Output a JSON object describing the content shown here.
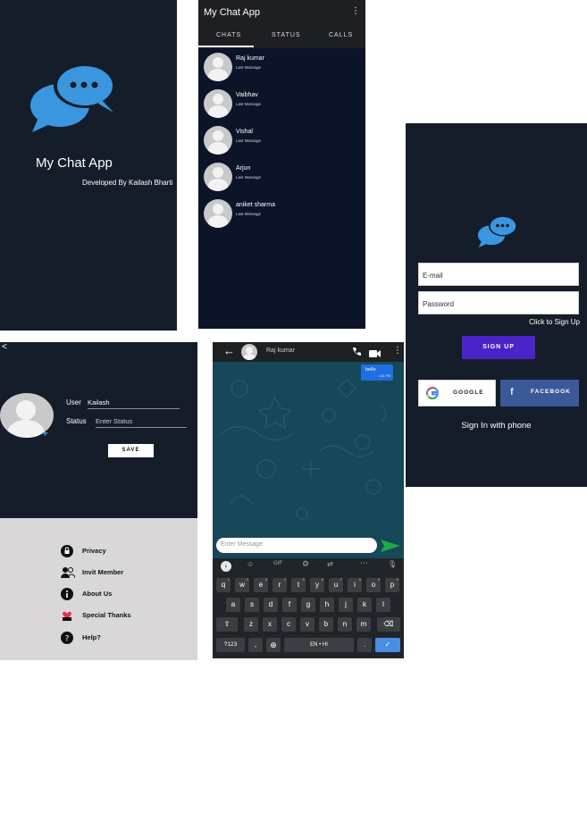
{
  "splash": {
    "title": "My Chat App",
    "developer": "Developed By Kailash Bharti"
  },
  "chat_list": {
    "app_title": "My Chat App",
    "menu_icon": "⋮",
    "tabs": [
      "CHATS",
      "STATUS",
      "CALLS"
    ],
    "chats": [
      {
        "name": "Raj kumar",
        "last": "Last Message"
      },
      {
        "name": "Vaibhav",
        "last": "Last Message"
      },
      {
        "name": "Vishal",
        "last": "Last Message"
      },
      {
        "name": "Arjun",
        "last": "Last Message"
      },
      {
        "name": "aniket sharma",
        "last": "Last Message"
      }
    ]
  },
  "signup": {
    "email_placeholder": "E-mail",
    "password_placeholder": "Password",
    "click_signup": "Click to Sign Up",
    "signup_button": "SIGN UP",
    "google_button": "GOOGLE",
    "facebook_button": "FACEBOOK",
    "phone_link": "Sign In with phone"
  },
  "profile": {
    "back": "<",
    "user_label": "User",
    "user_value": "Kailash",
    "status_label": "Status",
    "status_placeholder": "Enter Status",
    "save_button": "SAVE",
    "menu": [
      "Privacy",
      "Invit Member",
      "About Us",
      "Special Thanks",
      "Help?"
    ]
  },
  "chat_detail": {
    "contact": "Raj kumar",
    "message": "hello",
    "message_time": "4:31 PM",
    "input_placeholder": "Enter Message",
    "keyboard": {
      "row1": [
        "q",
        "w",
        "e",
        "r",
        "t",
        "y",
        "u",
        "i",
        "o",
        "p"
      ],
      "row1_hints": [
        "1",
        "2",
        "3",
        "4",
        "5",
        "6",
        "7",
        "8",
        "9",
        "0"
      ],
      "row2": [
        "a",
        "s",
        "d",
        "f",
        "g",
        "h",
        "j",
        "k",
        "l"
      ],
      "row3": [
        "z",
        "x",
        "c",
        "v",
        "b",
        "n",
        "m"
      ],
      "sym_key": "?123",
      "comma_key": ",",
      "period_key": ".",
      "space_label": "EN • HI"
    }
  },
  "colors": {
    "dark": "#141d29",
    "accent": "#3b96e0",
    "signup": "#4a24c9",
    "facebook": "#3b5998",
    "bubble": "#1e6fe0",
    "send": "#1faa4a"
  }
}
